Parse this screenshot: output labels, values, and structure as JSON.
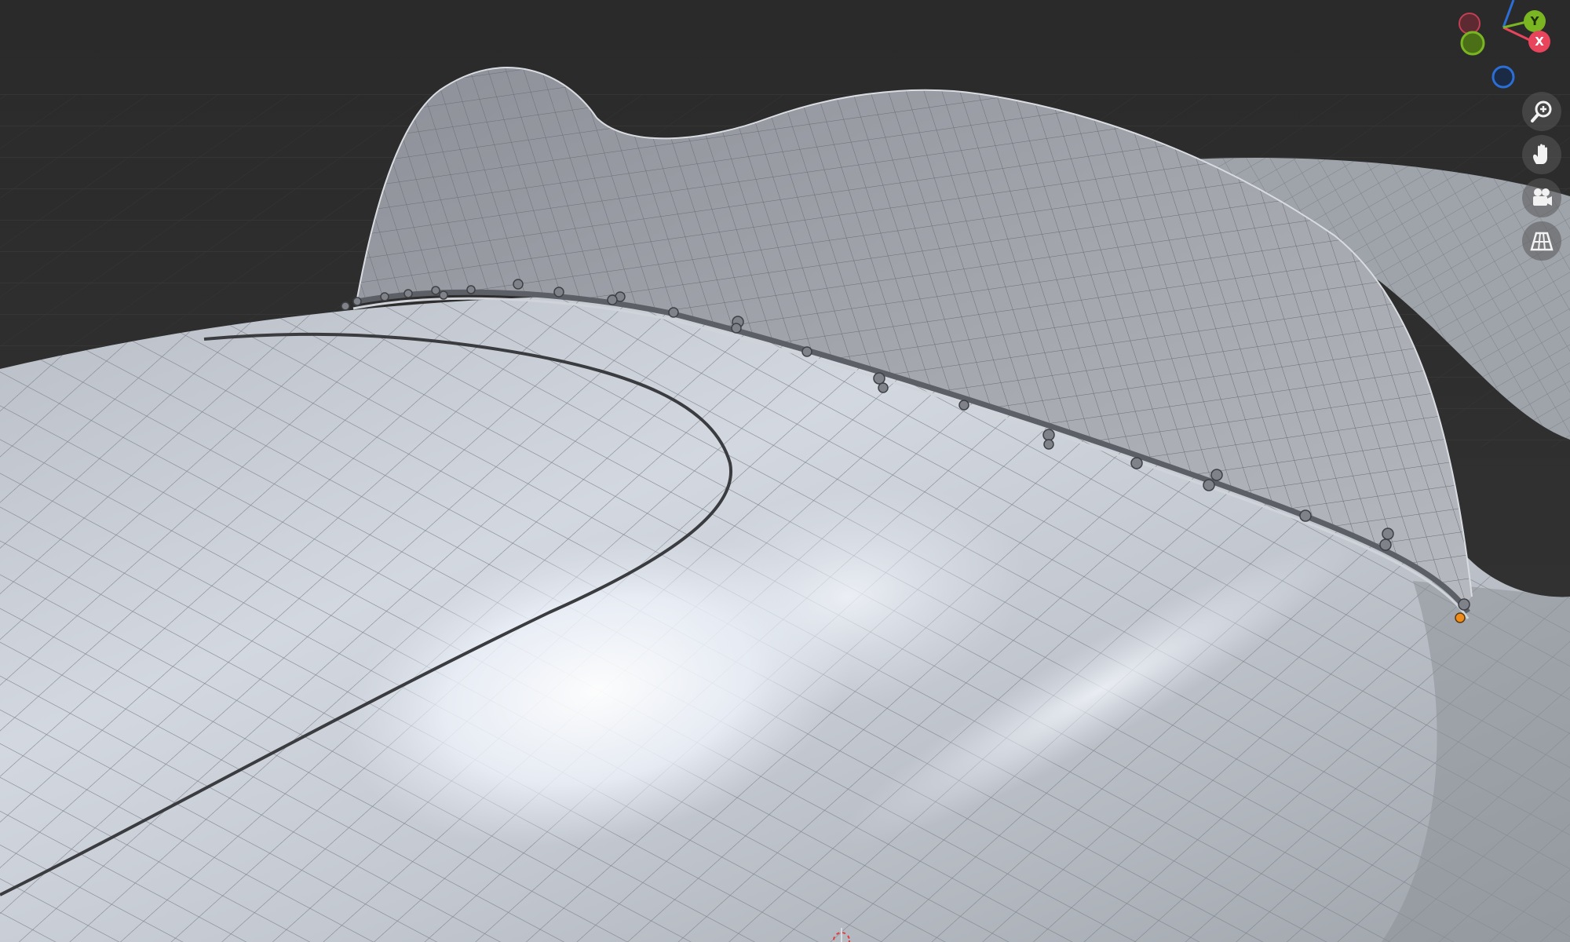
{
  "viewport": {
    "background": "#2d2d2d",
    "mesh_color": "#c9ced6",
    "wire_color": "#6f747c"
  },
  "gizmo": {
    "x_label": "X",
    "y_label": "Y",
    "x_color": "#e8455d",
    "y_color": "#7ab622",
    "z_color": "#2b6fd6"
  },
  "nav_buttons": [
    {
      "icon": "zoom-in-icon"
    },
    {
      "icon": "hand-pan-icon"
    },
    {
      "icon": "camera-icon"
    },
    {
      "icon": "perspective-grid-icon"
    }
  ],
  "scene": {
    "selected_vertex_color": "#f08c1a"
  }
}
